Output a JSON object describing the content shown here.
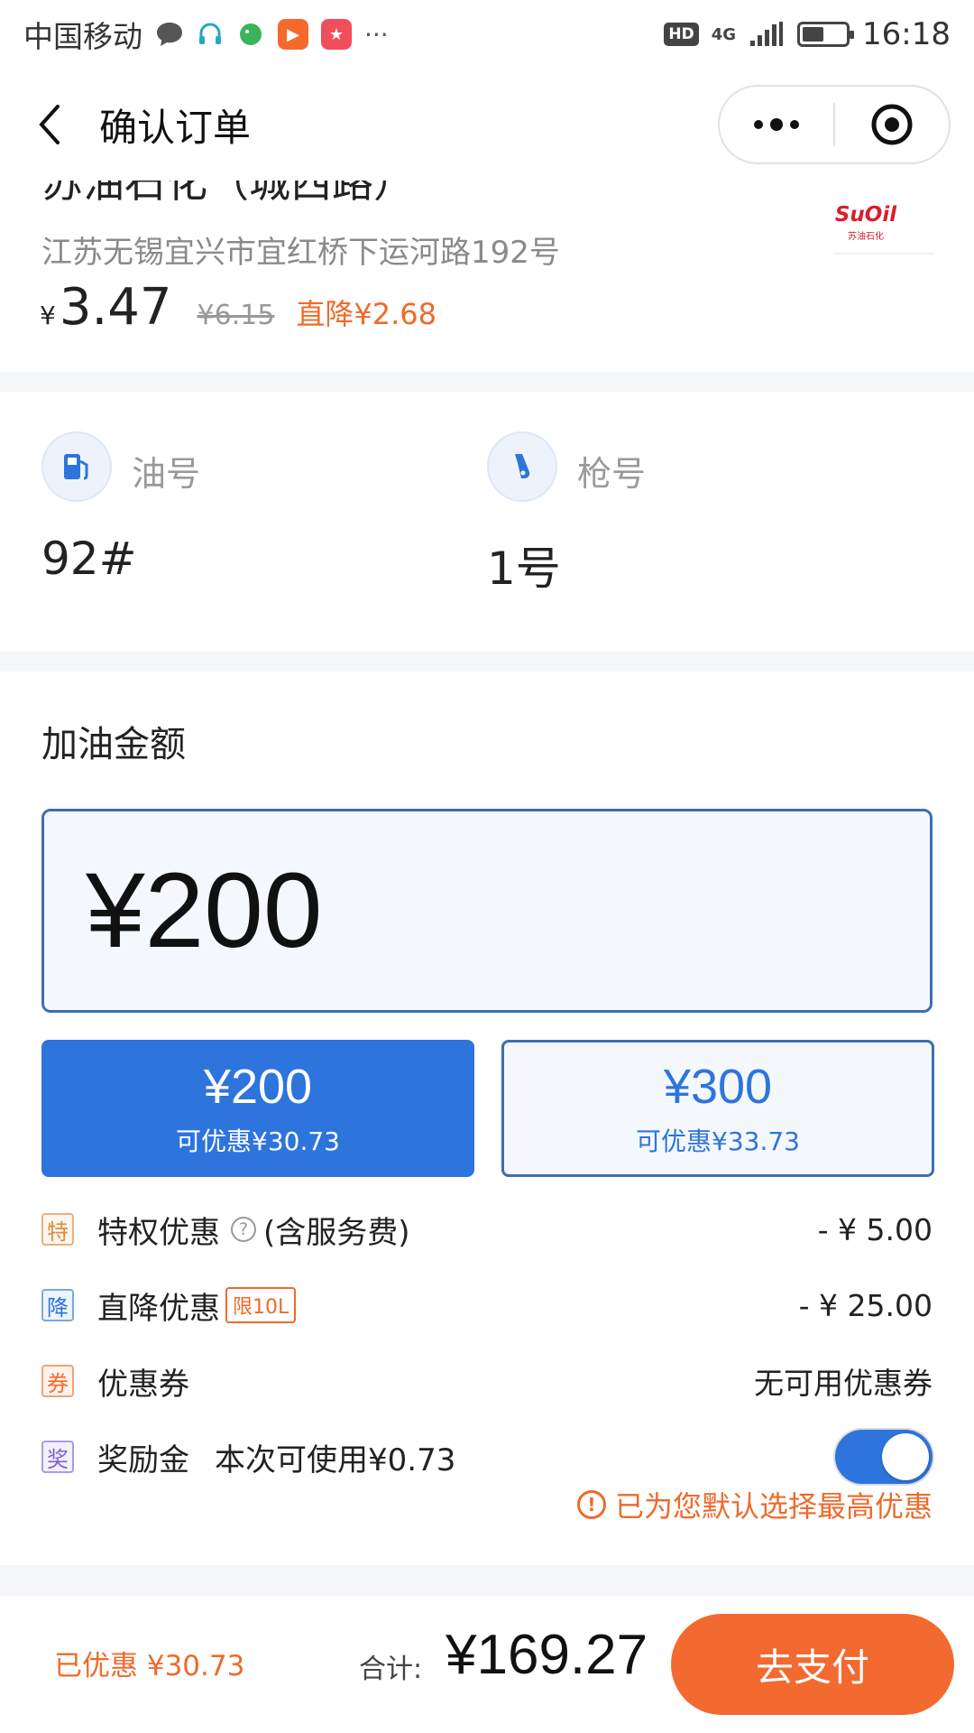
{
  "status_bar": {
    "carrier": "中国移动",
    "hd": "HD",
    "network": "4G",
    "time": "16:18",
    "battery_level": 0.5
  },
  "nav": {
    "title": "确认订单"
  },
  "station": {
    "name": "苏油石化（城西路）",
    "logo_text": "SuOil",
    "logo_sub": "苏油石化",
    "address": "江苏无锡宜兴市宜红桥下运河路192号",
    "currency": "¥",
    "price_now": "3.47",
    "price_old": "¥6.15",
    "price_cut": "直降¥2.68"
  },
  "fuel": {
    "oil_label": "油号",
    "oil_value": "92#",
    "gun_label": "枪号",
    "gun_value": "1号"
  },
  "amount": {
    "title": "加油金额",
    "input_value": "¥200",
    "options": [
      {
        "amount": "¥200",
        "discount": "可优惠¥30.73"
      },
      {
        "amount": "¥300",
        "discount": "可优惠¥33.73"
      }
    ]
  },
  "discounts": {
    "privilege": {
      "badge": "特",
      "label": "特权优惠",
      "help": "?",
      "note": "(含服务费)",
      "value": "- ¥ 5.00"
    },
    "direct": {
      "badge": "降",
      "label": "直降优惠",
      "tag": "限10L",
      "value": "- ¥ 25.00"
    },
    "coupon": {
      "badge": "券",
      "label": "优惠券",
      "value": "无可用优惠券"
    },
    "reward": {
      "badge": "奖",
      "label": "奖励金",
      "note": "本次可使用¥0.73",
      "enabled": true
    },
    "tip": "已为您默认选择最高优惠",
    "tip_icon": "!"
  },
  "footer": {
    "saved": "已优惠 ¥30.73",
    "total_label": "合计:",
    "total_value": "¥169.27",
    "pay_label": "去支付"
  },
  "colors": {
    "primary": "#2d74dc",
    "accent": "#f26a30",
    "outline": "#3d6fb0"
  }
}
